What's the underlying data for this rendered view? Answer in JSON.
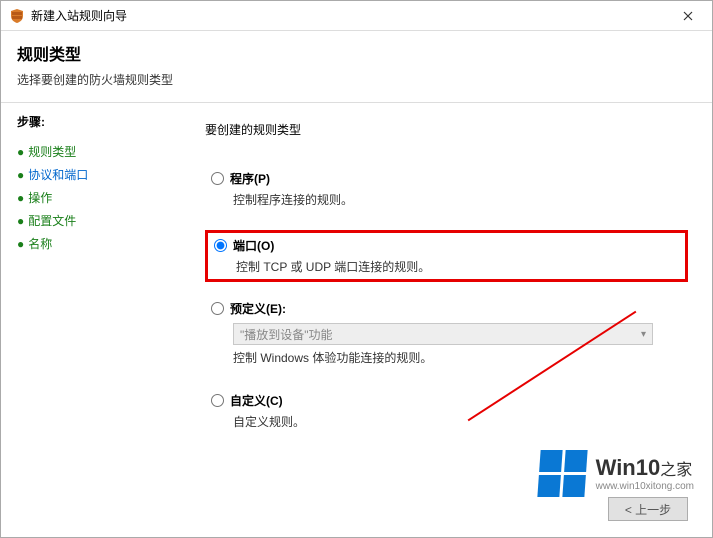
{
  "window": {
    "title": "新建入站规则向导"
  },
  "header": {
    "title": "规则类型",
    "subtitle": "选择要创建的防火墙规则类型"
  },
  "sidebar": {
    "steps_heading": "步骤:",
    "items": [
      {
        "label": "规则类型",
        "current": true,
        "link": false
      },
      {
        "label": "协议和端口",
        "current": false,
        "link": true
      },
      {
        "label": "操作",
        "current": false,
        "link": false
      },
      {
        "label": "配置文件",
        "current": false,
        "link": false
      },
      {
        "label": "名称",
        "current": false,
        "link": false
      }
    ]
  },
  "content": {
    "prompt": "要创建的规则类型",
    "options": {
      "program": {
        "label": "程序(P)",
        "desc": "控制程序连接的规则。",
        "checked": false
      },
      "port": {
        "label": "端口(O)",
        "desc": "控制 TCP 或 UDP 端口连接的规则。",
        "checked": true
      },
      "predefined": {
        "label": "预定义(E):",
        "desc": "控制 Windows 体验功能连接的规则。",
        "checked": false,
        "combo_value": "\"播放到设备\"功能",
        "disabled": true
      },
      "custom": {
        "label": "自定义(C)",
        "desc": "自定义规则。",
        "checked": false
      }
    }
  },
  "footer": {
    "back": "< 上一步"
  },
  "watermark": {
    "brand": "Win10",
    "suffix": "之家",
    "url": "www.win10xitong.com"
  }
}
